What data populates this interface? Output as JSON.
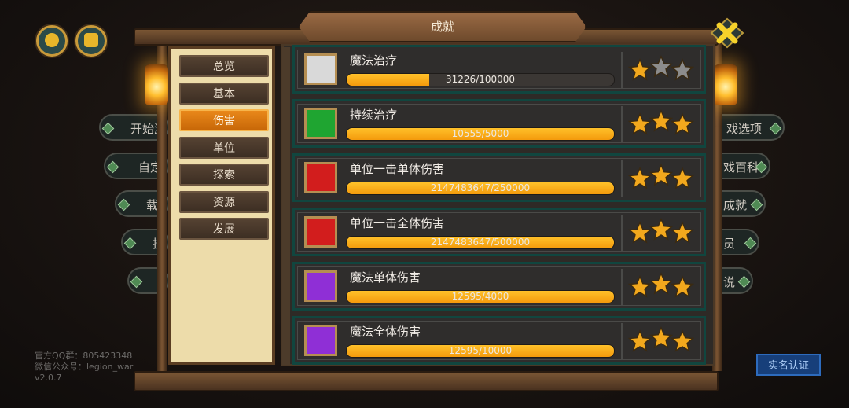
{
  "window": {
    "title": "成就"
  },
  "background_menu": {
    "left_items": [
      "开始游",
      "自定",
      "载",
      "挂",
      ""
    ],
    "right_items": [
      "戏选项",
      "戏百科",
      "成就",
      "员",
      "说"
    ],
    "footer": [
      "官方QQ群：805423348",
      "微信公众号：legion_war",
      "v2.0.7"
    ],
    "verify_button": "实名认证"
  },
  "tabs": [
    {
      "label": "总览",
      "active": false
    },
    {
      "label": "基本",
      "active": false
    },
    {
      "label": "伤害",
      "active": true
    },
    {
      "label": "单位",
      "active": false
    },
    {
      "label": "探索",
      "active": false
    },
    {
      "label": "资源",
      "active": false
    },
    {
      "label": "发展",
      "active": false
    }
  ],
  "achievements": [
    {
      "name": "魔法治疗",
      "progress_text": "31226/100000",
      "progress": 0.31,
      "stars": 1,
      "icon": "magic-heal-icon",
      "icon_color": "#d9d9d9"
    },
    {
      "name": "持续治疗",
      "progress_text": "10555/5000",
      "progress": 1.0,
      "stars": 3,
      "icon": "regen-icon",
      "icon_color": "#1fa531"
    },
    {
      "name": "单位一击单体伤害",
      "progress_text": "2147483647/250000",
      "progress": 1.0,
      "stars": 3,
      "icon": "single-strike-icon",
      "icon_color": "#d21d1d"
    },
    {
      "name": "单位一击全体伤害",
      "progress_text": "2147483647/500000",
      "progress": 1.0,
      "stars": 3,
      "icon": "group-strike-icon",
      "icon_color": "#d21d1d"
    },
    {
      "name": "魔法单体伤害",
      "progress_text": "12595/4000",
      "progress": 1.0,
      "stars": 3,
      "icon": "magic-single-icon",
      "icon_color": "#8f2fd6"
    },
    {
      "name": "魔法全体伤害",
      "progress_text": "12595/10000",
      "progress": 1.0,
      "stars": 3,
      "icon": "magic-group-icon",
      "icon_color": "#8f2fd6"
    }
  ],
  "colors": {
    "star_on": "#f2a81d",
    "star_off": "#8c8c8c",
    "accent": "#f49a0c"
  }
}
